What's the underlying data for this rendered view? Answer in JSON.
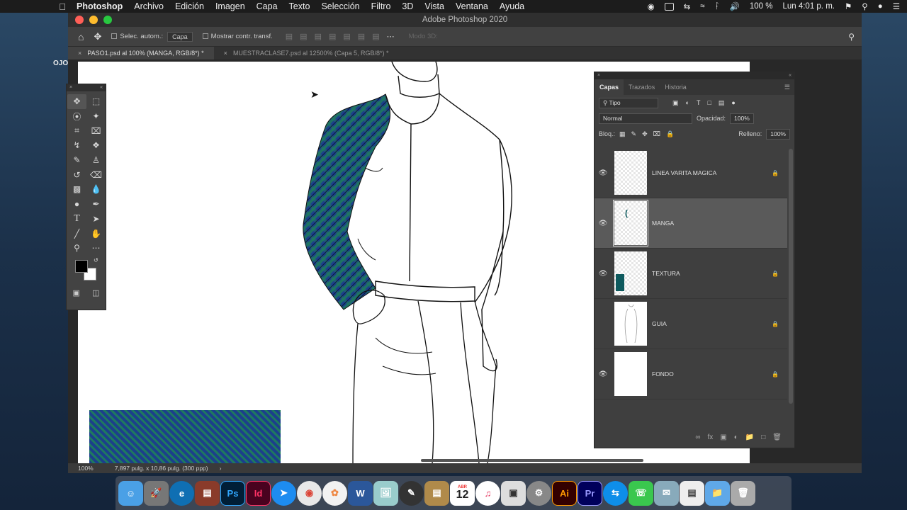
{
  "menubar": {
    "apple_icon": "apple-logo-icon",
    "items": [
      "Photoshop",
      "Archivo",
      "Edición",
      "Imagen",
      "Capa",
      "Texto",
      "Selección",
      "Filtro",
      "3D",
      "Vista",
      "Ventana",
      "Ayuda"
    ],
    "battery": "100 %",
    "clock": "Lun 4:01 p. m."
  },
  "desktop": {
    "label": "OJO"
  },
  "window": {
    "title": "Adobe Photoshop 2020",
    "options": {
      "auto_select_label": "Selec. autom.:",
      "auto_select_value": "Capa",
      "show_transform_label": "Mostrar contr. transf.",
      "mode3d_label": "Modo 3D:"
    },
    "tabs": [
      {
        "label": "PASO1.psd al 100% (MANGA, RGB/8*) *",
        "active": true
      },
      {
        "label": "MUESTRACLASE7.psd al 12500% (Capa 5, RGB/8*) *",
        "active": false
      }
    ],
    "status": {
      "zoom": "100%",
      "doc_info": "7,897 pulg. x 10,86 pulg. (300 ppp)"
    }
  },
  "layers_panel": {
    "tabs": [
      "Capas",
      "Trazados",
      "Historia"
    ],
    "filter_label": "Tipo",
    "blend_mode": "Normal",
    "opacity_label": "Opacidad:",
    "opacity_value": "100%",
    "lock_label": "Bloq.:",
    "fill_label": "Relleno:",
    "fill_value": "100%",
    "layers": [
      {
        "name": "LINEA VARITA MAGICA",
        "visible": true,
        "locked": true,
        "selected": false
      },
      {
        "name": "MANGA",
        "visible": true,
        "locked": false,
        "selected": true
      },
      {
        "name": "TEXTURA",
        "visible": true,
        "locked": true,
        "selected": false
      },
      {
        "name": "GUIA",
        "visible": false,
        "locked": true,
        "selected": false
      },
      {
        "name": "FONDO",
        "visible": true,
        "locked": true,
        "selected": false
      }
    ]
  },
  "colors": {
    "plaid_green": "#1e7a5e",
    "plaid_blue": "#1c3f8c",
    "teal": "#0e5a5e"
  },
  "dock": {
    "apps": [
      "finder-icon",
      "launchpad-icon",
      "edge-icon",
      "winrar-icon",
      "Ps",
      "Id",
      "safari-icon",
      "chrome-icon",
      "photos-icon",
      "W",
      "preview-icon",
      "pen-icon",
      "notes-icon",
      "12",
      "itunes-icon",
      "screenshot-icon",
      "settings-icon",
      "Ai",
      "Pr",
      "teamviewer-icon",
      "facetime-icon",
      "mail-icon",
      "docs-icon",
      "folder-icon",
      "trash-icon"
    ],
    "calendar_month": "ABR",
    "calendar_day": "12"
  }
}
